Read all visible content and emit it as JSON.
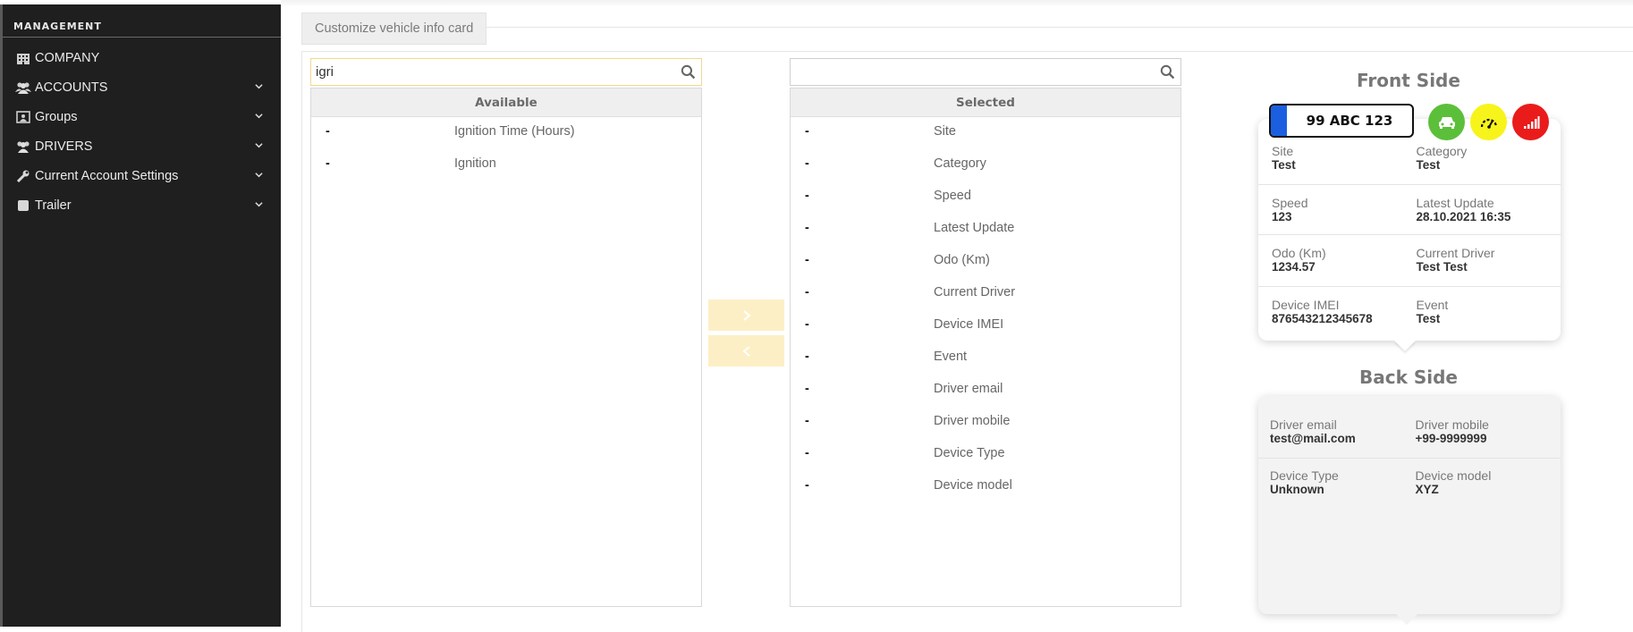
{
  "sidebar": {
    "heading": "MANAGEMENT",
    "items": [
      {
        "label": "COMPANY",
        "icon": "building-icon",
        "expandable": false
      },
      {
        "label": "ACCOUNTS",
        "icon": "users-icon",
        "expandable": true
      },
      {
        "label": "Groups",
        "icon": "group-box-icon",
        "expandable": true
      },
      {
        "label": "DRIVERS",
        "icon": "users-icon",
        "expandable": true
      },
      {
        "label": "Current Account Settings",
        "icon": "wrench-icon",
        "expandable": true
      },
      {
        "label": "Trailer",
        "icon": "square-icon",
        "expandable": true
      }
    ]
  },
  "header": {
    "tab_title": "Customize vehicle info card"
  },
  "available": {
    "search_value": "igri",
    "heading": "Available",
    "items": [
      "Ignition Time (Hours)",
      "Ignition"
    ]
  },
  "selected": {
    "search_value": "",
    "heading": "Selected",
    "items": [
      "Site",
      "Category",
      "Speed",
      "Latest Update",
      "Odo (Km)",
      "Current Driver",
      "Device IMEI",
      "Event",
      "Driver email",
      "Driver mobile",
      "Device Type",
      "Device model"
    ]
  },
  "move": {
    "right_icon": "chevron-right-icon",
    "left_icon": "chevron-left-icon"
  },
  "preview": {
    "front_title": "Front Side",
    "back_title": "Back Side",
    "plate": "99 ABC 123",
    "status_colors": {
      "car": "#5cbf3a",
      "speed": "#f7f41b",
      "signal": "#ea1b1b"
    },
    "front_rows": [
      [
        {
          "k": "Site",
          "v": "Test"
        },
        {
          "k": "Category",
          "v": "Test"
        }
      ],
      [
        {
          "k": "Speed",
          "v": "123"
        },
        {
          "k": "Latest Update",
          "v": "28.10.2021 16:35"
        }
      ],
      [
        {
          "k": "Odo (Km)",
          "v": "1234.57"
        },
        {
          "k": "Current Driver",
          "v": "Test Test"
        }
      ],
      [
        {
          "k": "Device IMEI",
          "v": "876543212345678"
        },
        {
          "k": "Event",
          "v": "Test"
        }
      ]
    ],
    "back_rows": [
      [
        {
          "k": "Driver email",
          "v": "test@mail.com"
        },
        {
          "k": "Driver mobile",
          "v": "+99-9999999"
        }
      ],
      [
        {
          "k": "Device Type",
          "v": "Unknown"
        },
        {
          "k": "Device model",
          "v": "XYZ"
        }
      ]
    ]
  },
  "colors": {
    "sidebar_bg": "#1f1f1f",
    "accent_yellow": "#fdefc5",
    "plate_blue": "#1b5fe0"
  }
}
